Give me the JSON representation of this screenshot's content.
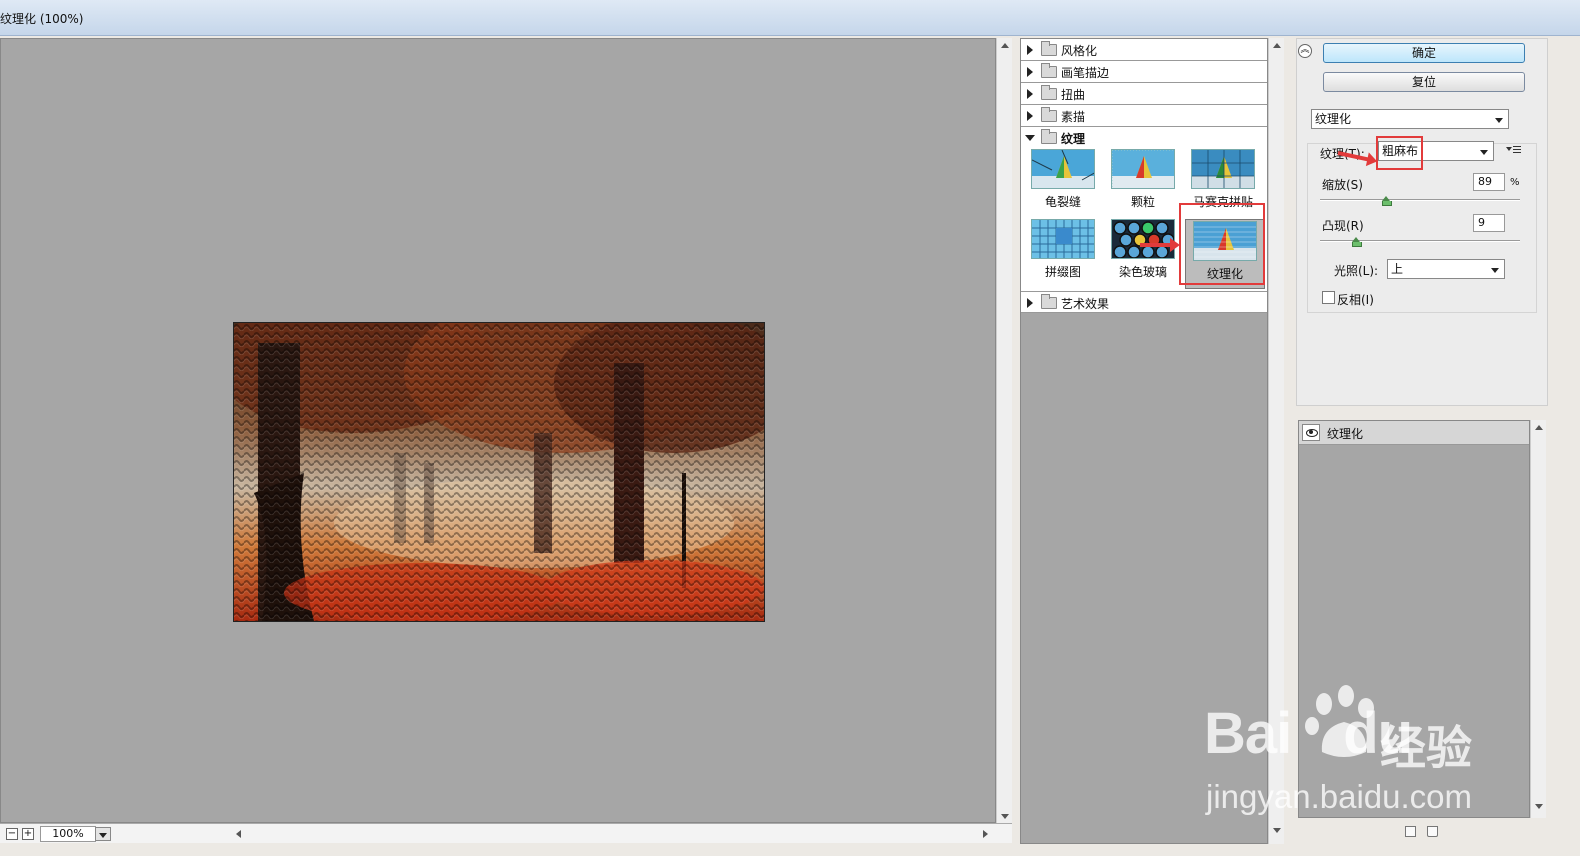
{
  "window": {
    "title": "纹理化 (100%)"
  },
  "preview": {
    "zoom": "100%"
  },
  "gallery": {
    "categories_top": [
      "风格化",
      "画笔描边",
      "扭曲",
      "素描"
    ],
    "open_category": "纹理",
    "thumbs": [
      "龟裂缝",
      "颗粒",
      "马赛克拼贴",
      "拼缀图",
      "染色玻璃",
      "纹理化"
    ],
    "selected_thumb": "纹理化",
    "categories_bottom": [
      "艺术效果"
    ]
  },
  "buttons": {
    "ok": "确定",
    "reset": "复位"
  },
  "filter_select": {
    "value": "纹理化"
  },
  "settings": {
    "texture_label": "纹理(T):",
    "texture_value": "粗麻布",
    "scaling_label": "缩放(S)",
    "scaling_value": "89",
    "scaling_unit": "%",
    "scaling_fraction": 0.33,
    "relief_label": "凸现(R)",
    "relief_value": "9",
    "relief_fraction": 0.18,
    "light_label": "光照(L):",
    "light_value": "上",
    "invert_label": "反相(I)",
    "invert_checked": false
  },
  "layers": {
    "layer_name": "纹理化"
  },
  "watermark": {
    "brand": "Bai",
    "brand2": "du",
    "cn": "经验",
    "url": "jingyan.baidu.com"
  },
  "colors": {
    "annotation": "#e23b3b",
    "canvas_gray": "#a6a6a6",
    "primary_button": "#bde6fb"
  }
}
